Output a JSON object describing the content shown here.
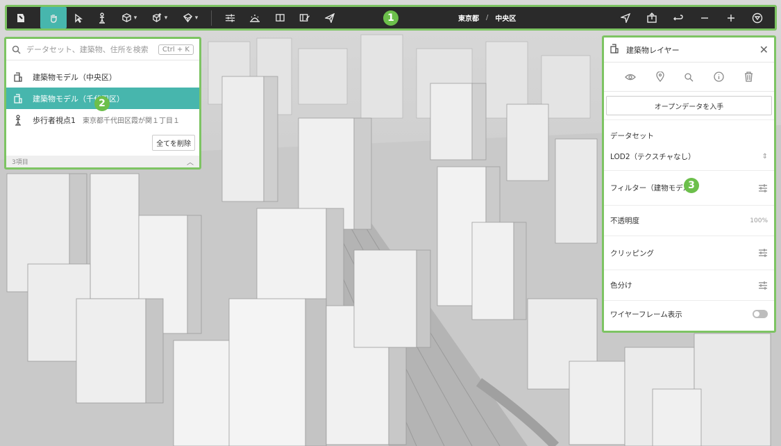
{
  "toolbar": {
    "breadcrumb": {
      "prefecture": "東京都",
      "separator": "/",
      "ward": "中央区"
    },
    "left_tools": [
      "logo-icon",
      "hand-icon",
      "pointer-icon",
      "pedestrian-icon",
      "cube-icon",
      "cube-plus-icon",
      "polygon-icon",
      "sliders-icon",
      "sun-icon",
      "map-book-icon",
      "edit-map-icon",
      "send-icon"
    ],
    "right_tools": [
      "navigate-icon",
      "share-icon",
      "undo-icon",
      "minus-icon",
      "plus-icon",
      "filter-icon"
    ]
  },
  "markers": {
    "toolbar": "1",
    "search_panel": "2",
    "layer_panel": "3"
  },
  "search": {
    "placeholder": "データセット、建築物、住所を検索",
    "shortcut": "Ctrl + K",
    "items": [
      {
        "label": "建築物モデル（中央区）",
        "icon": "building-icon",
        "sub": ""
      },
      {
        "label": "建築物モデル（千代田区）",
        "icon": "building-icon",
        "sub": ""
      },
      {
        "label": "歩行者視点1",
        "icon": "pedestrian-icon",
        "sub": "東京都千代田区霞が関１丁目１"
      }
    ],
    "delete_all": "全てを削除",
    "count": "3項目"
  },
  "layer_panel": {
    "title": "建築物レイヤー",
    "icons": [
      "eye-icon",
      "pin-icon",
      "search-icon",
      "info-icon",
      "trash-icon"
    ],
    "open_data": "オープンデータを入手",
    "dataset_label": "データセット",
    "dataset_value": "LOD2（テクスチャなし）",
    "filter": "フィルター（建物モデル）",
    "opacity_label": "不透明度",
    "opacity_value": "100%",
    "clipping": "クリッピング",
    "color_split": "色分け",
    "wireframe": "ワイヤーフレーム表示",
    "wireframe_on": false
  },
  "colors": {
    "accent": "#47b6ad",
    "frame": "#7dc463",
    "toolbar_bg": "#2a2a2a"
  }
}
